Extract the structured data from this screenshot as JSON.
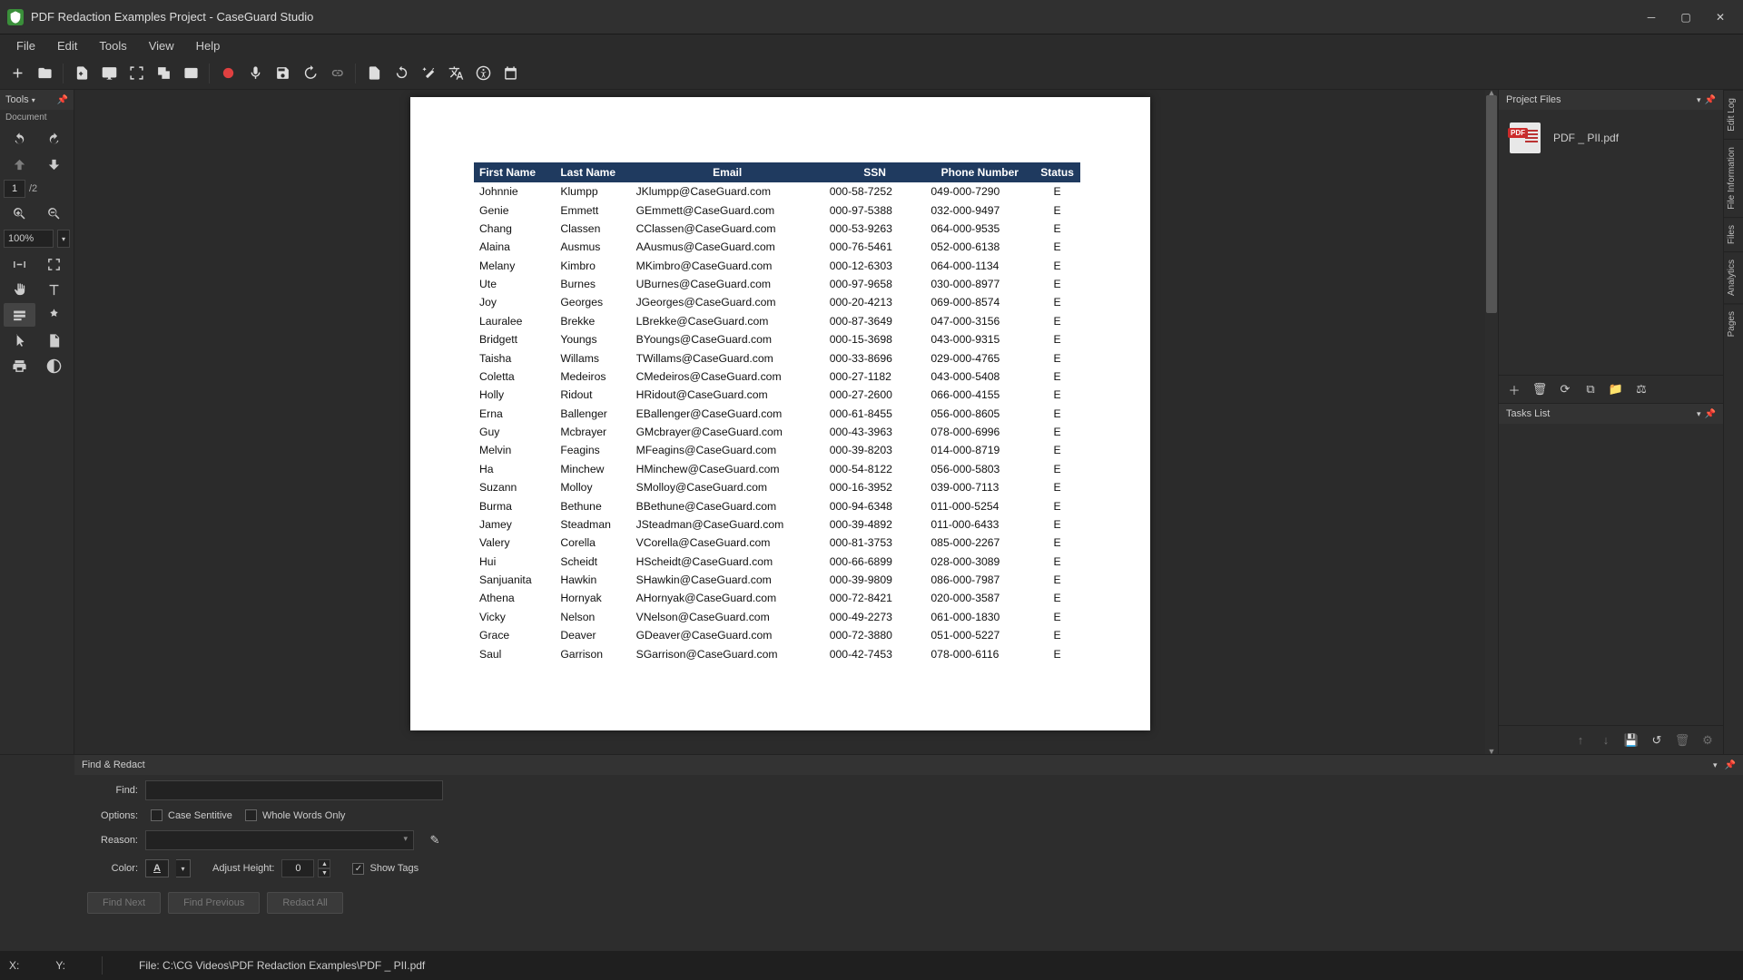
{
  "window": {
    "title": "PDF Redaction Examples Project - CaseGuard Studio"
  },
  "menu": {
    "items": [
      "File",
      "Edit",
      "Tools",
      "View",
      "Help"
    ]
  },
  "tools_panel": {
    "title": "Tools",
    "subtitle": "Document",
    "page_current": "1",
    "page_total": "/2",
    "zoom": "100%"
  },
  "doc": {
    "columns": [
      "First Name",
      "Last Name",
      "Email",
      "SSN",
      "Phone Number",
      "Status"
    ],
    "rows": [
      [
        "Johnnie",
        "Klumpp",
        "JKlumpp@CaseGuard.com",
        "000-58-7252",
        "049-000-7290",
        "E"
      ],
      [
        "Genie",
        "Emmett",
        "GEmmett@CaseGuard.com",
        "000-97-5388",
        "032-000-9497",
        "E"
      ],
      [
        "Chang",
        "Classen",
        "CClassen@CaseGuard.com",
        "000-53-9263",
        "064-000-9535",
        "E"
      ],
      [
        "Alaina",
        "Ausmus",
        "AAusmus@CaseGuard.com",
        "000-76-5461",
        "052-000-6138",
        "E"
      ],
      [
        "Melany",
        "Kimbro",
        "MKimbro@CaseGuard.com",
        "000-12-6303",
        "064-000-1134",
        "E"
      ],
      [
        "Ute",
        "Burnes",
        "UBurnes@CaseGuard.com",
        "000-97-9658",
        "030-000-8977",
        "E"
      ],
      [
        "Joy",
        "Georges",
        "JGeorges@CaseGuard.com",
        "000-20-4213",
        "069-000-8574",
        "E"
      ],
      [
        "Lauralee",
        "Brekke",
        "LBrekke@CaseGuard.com",
        "000-87-3649",
        "047-000-3156",
        "E"
      ],
      [
        "Bridgett",
        "Youngs",
        "BYoungs@CaseGuard.com",
        "000-15-3698",
        "043-000-9315",
        "E"
      ],
      [
        "Taisha",
        "Willams",
        "TWillams@CaseGuard.com",
        "000-33-8696",
        "029-000-4765",
        "E"
      ],
      [
        "Coletta",
        "Medeiros",
        "CMedeiros@CaseGuard.com",
        "000-27-1182",
        "043-000-5408",
        "E"
      ],
      [
        "Holly",
        "Ridout",
        "HRidout@CaseGuard.com",
        "000-27-2600",
        "066-000-4155",
        "E"
      ],
      [
        "Erna",
        "Ballenger",
        "EBallenger@CaseGuard.com",
        "000-61-8455",
        "056-000-8605",
        "E"
      ],
      [
        "Guy",
        "Mcbrayer",
        "GMcbrayer@CaseGuard.com",
        "000-43-3963",
        "078-000-6996",
        "E"
      ],
      [
        "Melvin",
        "Feagins",
        "MFeagins@CaseGuard.com",
        "000-39-8203",
        "014-000-8719",
        "E"
      ],
      [
        "Ha",
        "Minchew",
        "HMinchew@CaseGuard.com",
        "000-54-8122",
        "056-000-5803",
        "E"
      ],
      [
        "Suzann",
        "Molloy",
        "SMolloy@CaseGuard.com",
        "000-16-3952",
        "039-000-7113",
        "E"
      ],
      [
        "Burma",
        "Bethune",
        "BBethune@CaseGuard.com",
        "000-94-6348",
        "011-000-5254",
        "E"
      ],
      [
        "Jamey",
        "Steadman",
        "JSteadman@CaseGuard.com",
        "000-39-4892",
        "011-000-6433",
        "E"
      ],
      [
        "Valery",
        "Corella",
        "VCorella@CaseGuard.com",
        "000-81-3753",
        "085-000-2267",
        "E"
      ],
      [
        "Hui",
        "Scheidt",
        "HScheidt@CaseGuard.com",
        "000-66-6899",
        "028-000-3089",
        "E"
      ],
      [
        "Sanjuanita",
        "Hawkin",
        "SHawkin@CaseGuard.com",
        "000-39-9809",
        "086-000-7987",
        "E"
      ],
      [
        "Athena",
        "Hornyak",
        "AHornyak@CaseGuard.com",
        "000-72-8421",
        "020-000-3587",
        "E"
      ],
      [
        "Vicky",
        "Nelson",
        "VNelson@CaseGuard.com",
        "000-49-2273",
        "061-000-1830",
        "E"
      ],
      [
        "Grace",
        "Deaver",
        "GDeaver@CaseGuard.com",
        "000-72-3880",
        "051-000-5227",
        "E"
      ],
      [
        "Saul",
        "Garrison",
        "SGarrison@CaseGuard.com",
        "000-42-7453",
        "078-000-6116",
        "E"
      ]
    ]
  },
  "project_files": {
    "title": "Project Files",
    "items": [
      {
        "name": "PDF _ PII.pdf"
      }
    ]
  },
  "tasks": {
    "title": "Tasks List"
  },
  "vtabs": [
    "Edit Log",
    "File Information",
    "Files",
    "Analytics",
    "Pages"
  ],
  "find": {
    "title": "Find & Redact",
    "find_label": "Find:",
    "options_label": "Options:",
    "case_label": "Case Sentitive",
    "whole_label": "Whole Words Only",
    "reason_label": "Reason:",
    "color_label": "Color:",
    "adjust_label": "Adjust Height:",
    "adjust_value": "0",
    "showtags_label": "Show Tags",
    "btn_findnext": "Find Next",
    "btn_findprev": "Find Previous",
    "btn_redactall": "Redact All"
  },
  "status": {
    "x": "X:",
    "y": "Y:",
    "file": "File: C:\\CG Videos\\PDF Redaction Examples\\PDF _ PII.pdf"
  }
}
